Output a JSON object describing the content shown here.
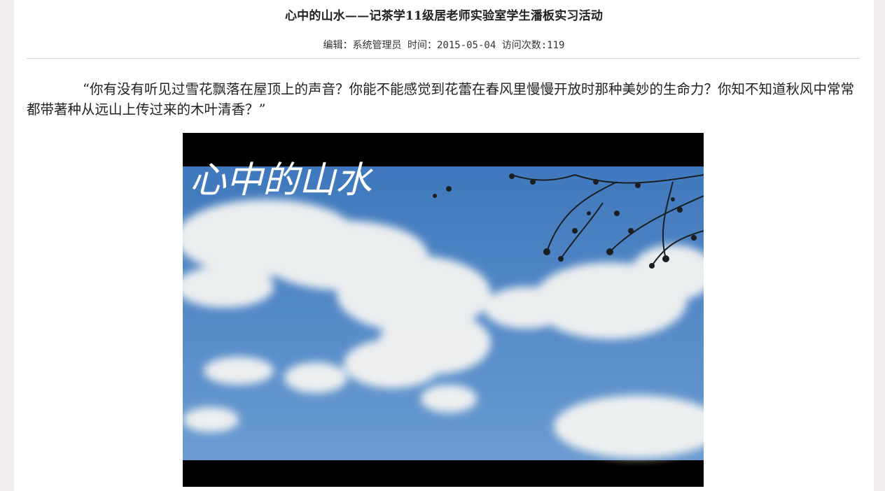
{
  "article": {
    "title": "心中的山水——记茶学11级居老师实验室学生潘板实习活动",
    "meta": {
      "editor_label": "编辑：",
      "editor": "系统管理员",
      "time_label": "时间：",
      "date": "2015-05-04",
      "visits_label": "访问次数:",
      "visits": "119"
    },
    "paragraph": "“你有没有听见过雪花飘落在屋顶上的声音？你能不能感觉到花蕾在春风里慢慢开放时那种美妙的生命力？你知不知道秋风中常常都带著种从远山上传过来的木叶清香？”",
    "image": {
      "overlay_text": "心中的山水",
      "sky_color": "#4f86c6"
    }
  }
}
